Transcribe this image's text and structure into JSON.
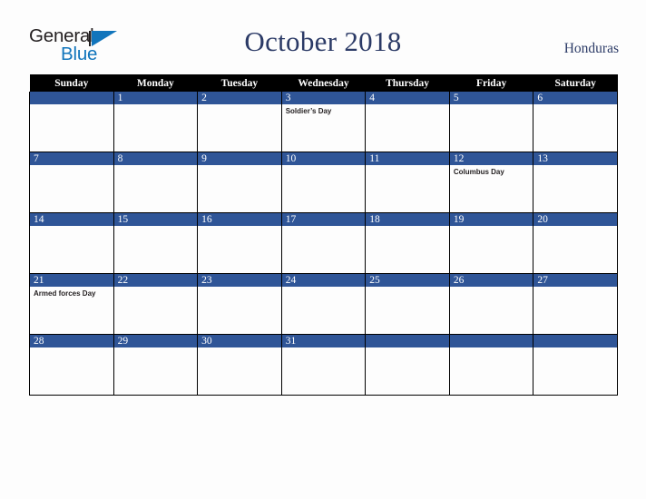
{
  "brand": {
    "name_part1": "General",
    "name_part2": "Blue",
    "triangle_color": "#1175bc",
    "text_color": "#231f20"
  },
  "header": {
    "title": "October 2018",
    "country": "Honduras",
    "title_color": "#2b3a66"
  },
  "calendar": {
    "weekday_headers": [
      "Sunday",
      "Monday",
      "Tuesday",
      "Wednesday",
      "Thursday",
      "Friday",
      "Saturday"
    ],
    "header_bg": "#000000",
    "daynum_bg": "#2f5597",
    "grid_border": "#000000",
    "cell_bg": "#fdfdfd",
    "weeks": [
      [
        {
          "day": "",
          "event": ""
        },
        {
          "day": "1",
          "event": ""
        },
        {
          "day": "2",
          "event": ""
        },
        {
          "day": "3",
          "event": "Soldier’s Day"
        },
        {
          "day": "4",
          "event": ""
        },
        {
          "day": "5",
          "event": ""
        },
        {
          "day": "6",
          "event": ""
        }
      ],
      [
        {
          "day": "7",
          "event": ""
        },
        {
          "day": "8",
          "event": ""
        },
        {
          "day": "9",
          "event": ""
        },
        {
          "day": "10",
          "event": ""
        },
        {
          "day": "11",
          "event": ""
        },
        {
          "day": "12",
          "event": "Columbus Day"
        },
        {
          "day": "13",
          "event": ""
        }
      ],
      [
        {
          "day": "14",
          "event": ""
        },
        {
          "day": "15",
          "event": ""
        },
        {
          "day": "16",
          "event": ""
        },
        {
          "day": "17",
          "event": ""
        },
        {
          "day": "18",
          "event": ""
        },
        {
          "day": "19",
          "event": ""
        },
        {
          "day": "20",
          "event": ""
        }
      ],
      [
        {
          "day": "21",
          "event": "Armed forces Day"
        },
        {
          "day": "22",
          "event": ""
        },
        {
          "day": "23",
          "event": ""
        },
        {
          "day": "24",
          "event": ""
        },
        {
          "day": "25",
          "event": ""
        },
        {
          "day": "26",
          "event": ""
        },
        {
          "day": "27",
          "event": ""
        }
      ],
      [
        {
          "day": "28",
          "event": ""
        },
        {
          "day": "29",
          "event": ""
        },
        {
          "day": "30",
          "event": ""
        },
        {
          "day": "31",
          "event": ""
        },
        {
          "day": "",
          "event": ""
        },
        {
          "day": "",
          "event": ""
        },
        {
          "day": "",
          "event": ""
        }
      ]
    ]
  }
}
